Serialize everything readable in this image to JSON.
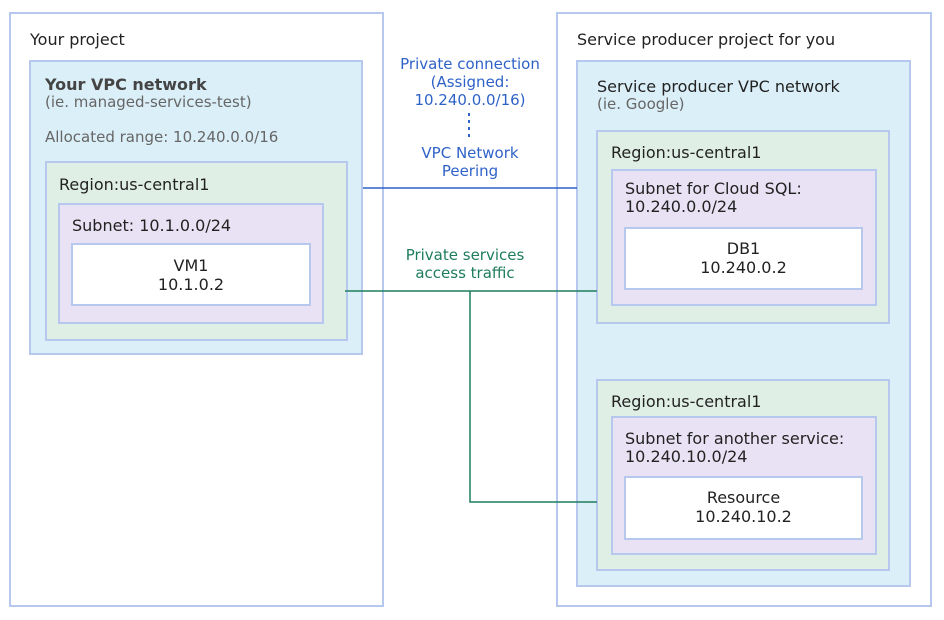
{
  "left_project": {
    "title": "Your project",
    "vpc_title": "Your VPC network",
    "vpc_subtitle": "(ie. managed-services-test)",
    "allocated_range": "Allocated range: 10.240.0.0/16",
    "region": "Region:us-central1",
    "subnet": "Subnet: 10.1.0.0/24",
    "vm": {
      "name": "VM1",
      "ip": "10.1.0.2"
    }
  },
  "right_project": {
    "title": "Service producer project for you",
    "vpc_title": "Service producer VPC network",
    "vpc_subtitle": "(ie. Google)",
    "region1": {
      "region": "Region:us-central1",
      "subnet_line1": "Subnet for Cloud SQL:",
      "subnet_line2": "10.240.0.0/24",
      "resource_name": "DB1",
      "resource_ip": "10.240.0.2"
    },
    "region2": {
      "region": "Region:us-central1",
      "subnet_line1": "Subnet for another service:",
      "subnet_line2": "10.240.10.0/24",
      "resource_name": "Resource",
      "resource_ip": "10.240.10.2"
    }
  },
  "connection": {
    "private_line1": "Private connection",
    "private_line2": "(Assigned:",
    "private_line3": "10.240.0.0/16)",
    "peering_line1": "VPC Network",
    "peering_line2": "Peering",
    "traffic_line1": "Private services",
    "traffic_line2": "access traffic"
  },
  "colors": {
    "peering_line": "#2f62c8",
    "traffic_line": "#1e7d5e",
    "border": "#b6c8ee"
  }
}
